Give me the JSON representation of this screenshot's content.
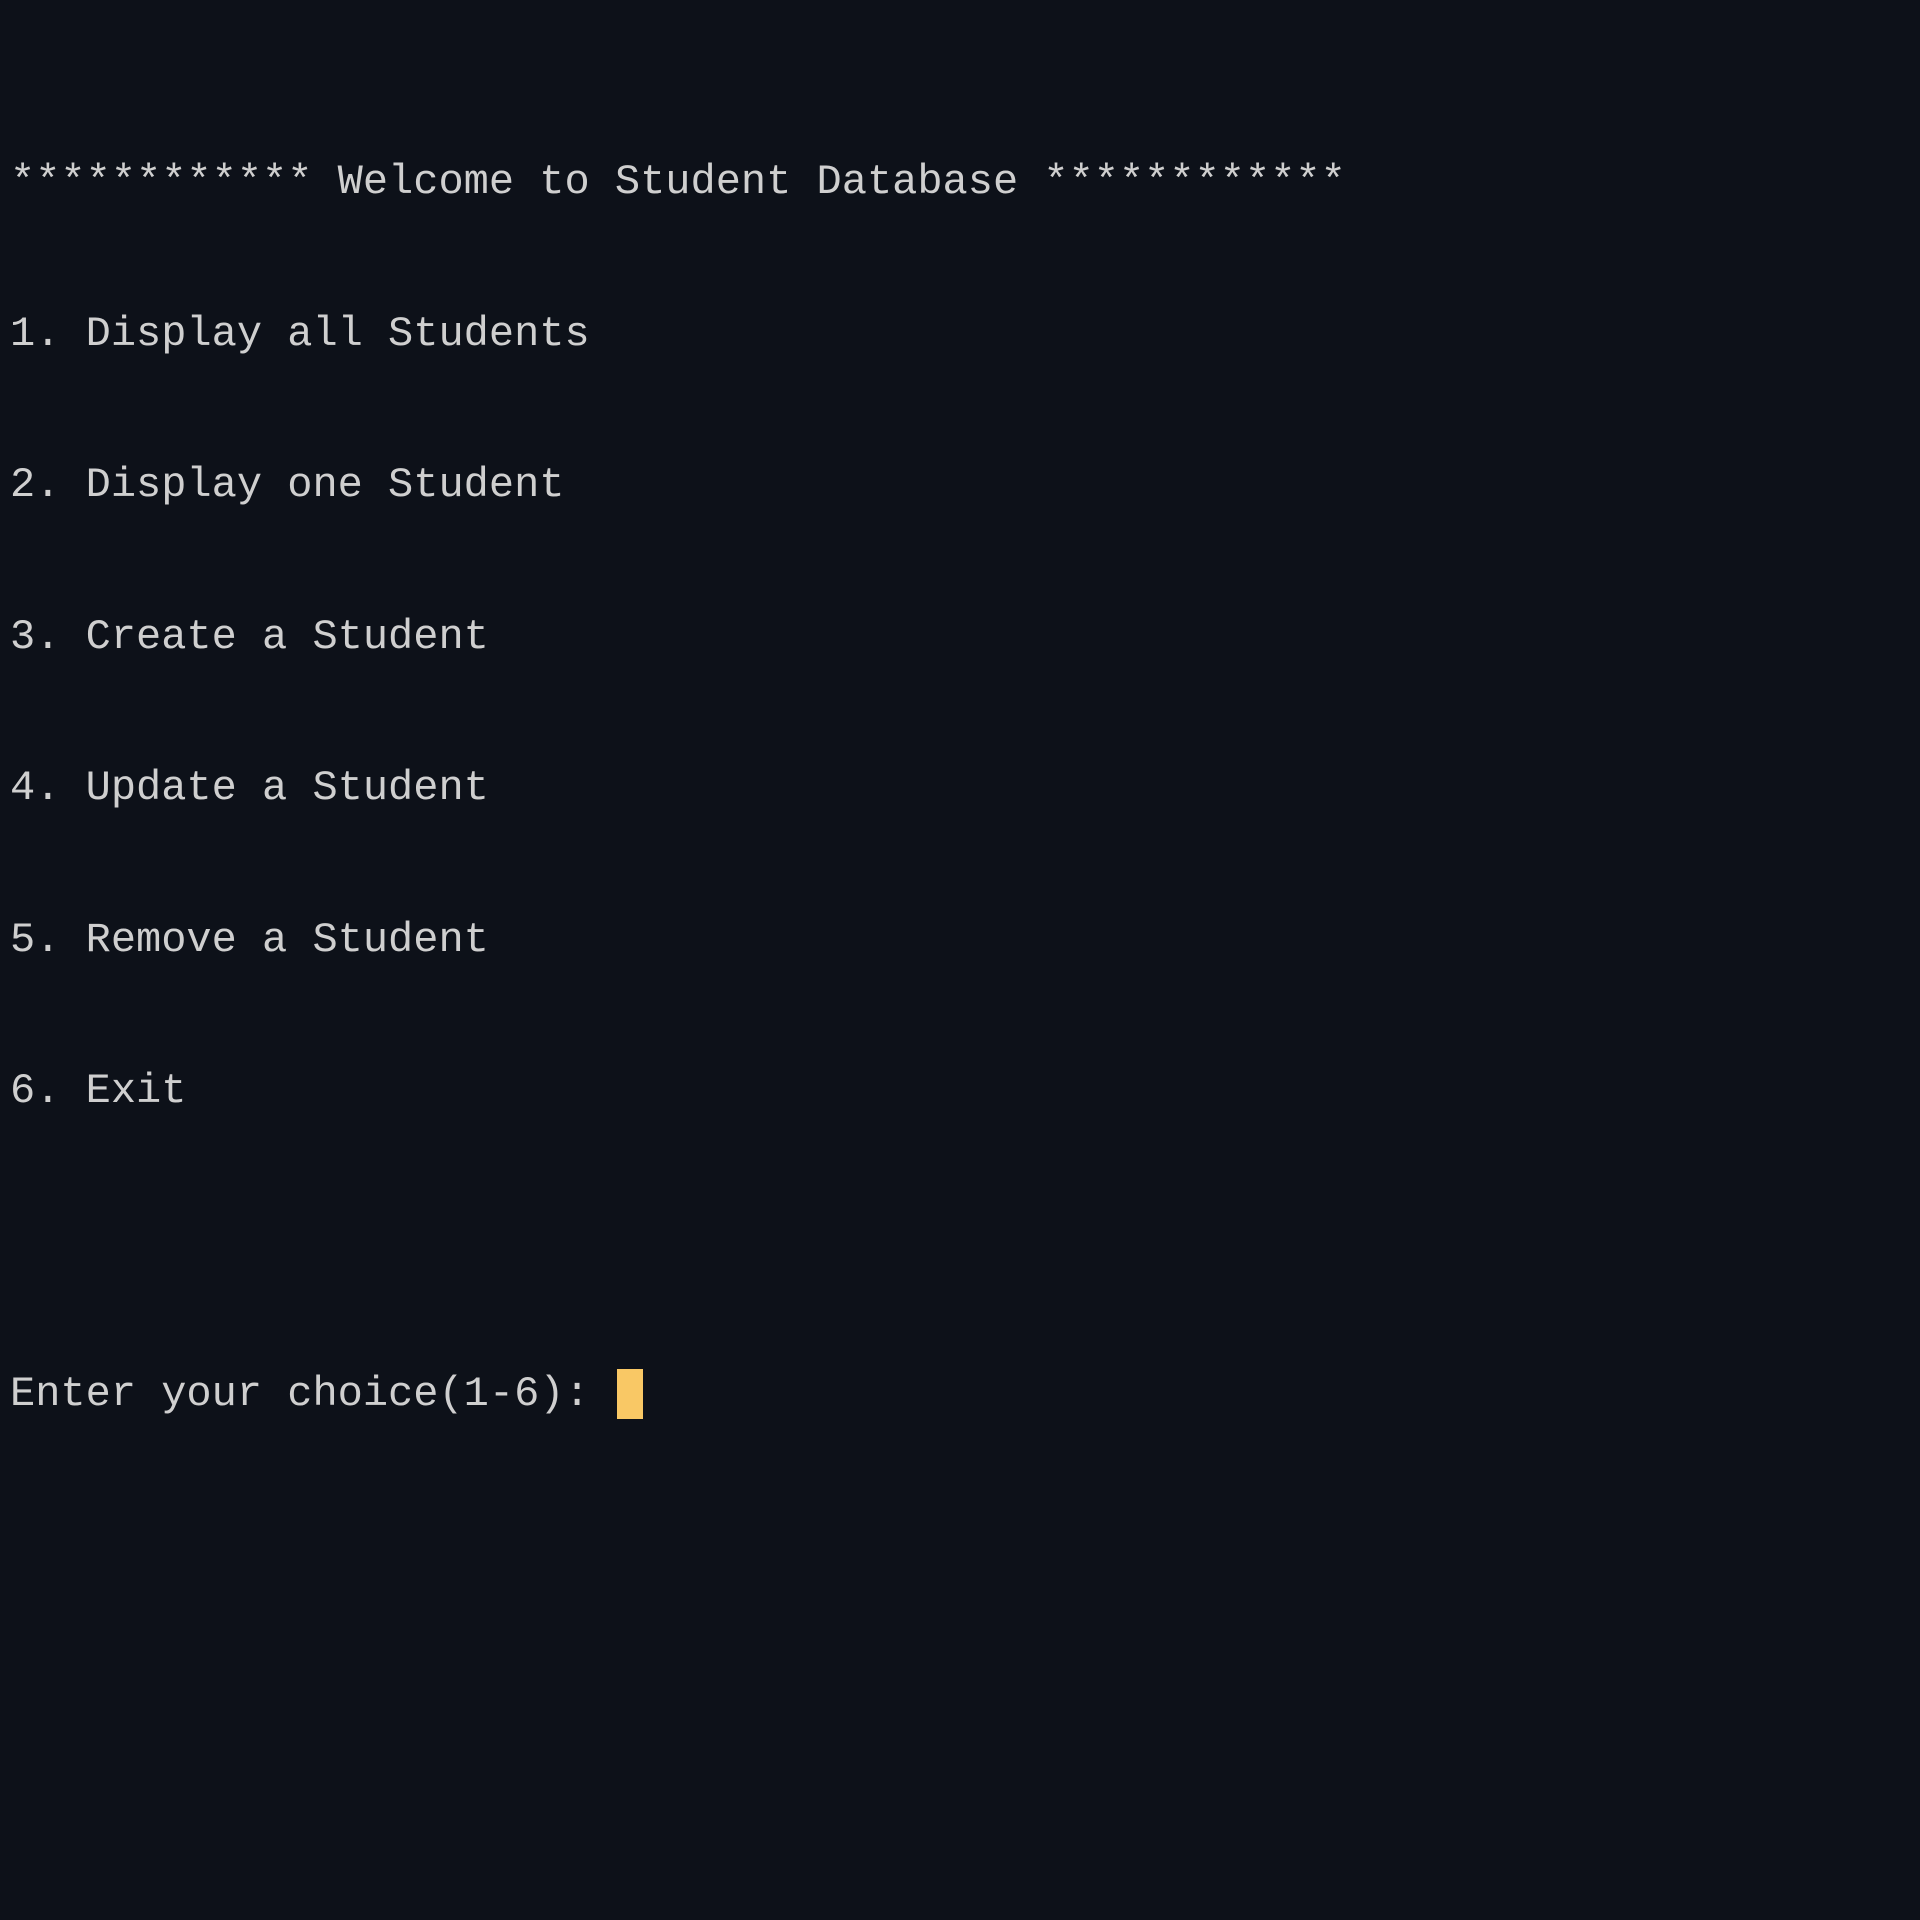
{
  "terminal": {
    "banner": "************ Welcome to Student Database ************",
    "menu": [
      {
        "label": "1. Display all Students"
      },
      {
        "label": "2. Display one Student"
      },
      {
        "label": "3. Create a Student"
      },
      {
        "label": "4. Update a Student"
      },
      {
        "label": "5. Remove a Student"
      },
      {
        "label": "6. Exit"
      }
    ],
    "prompt": "Enter your choice(1-6): ",
    "input_value": ""
  },
  "colors": {
    "background": "#0d1119",
    "text": "#cfcfcf",
    "cursor": "#f9c865"
  }
}
